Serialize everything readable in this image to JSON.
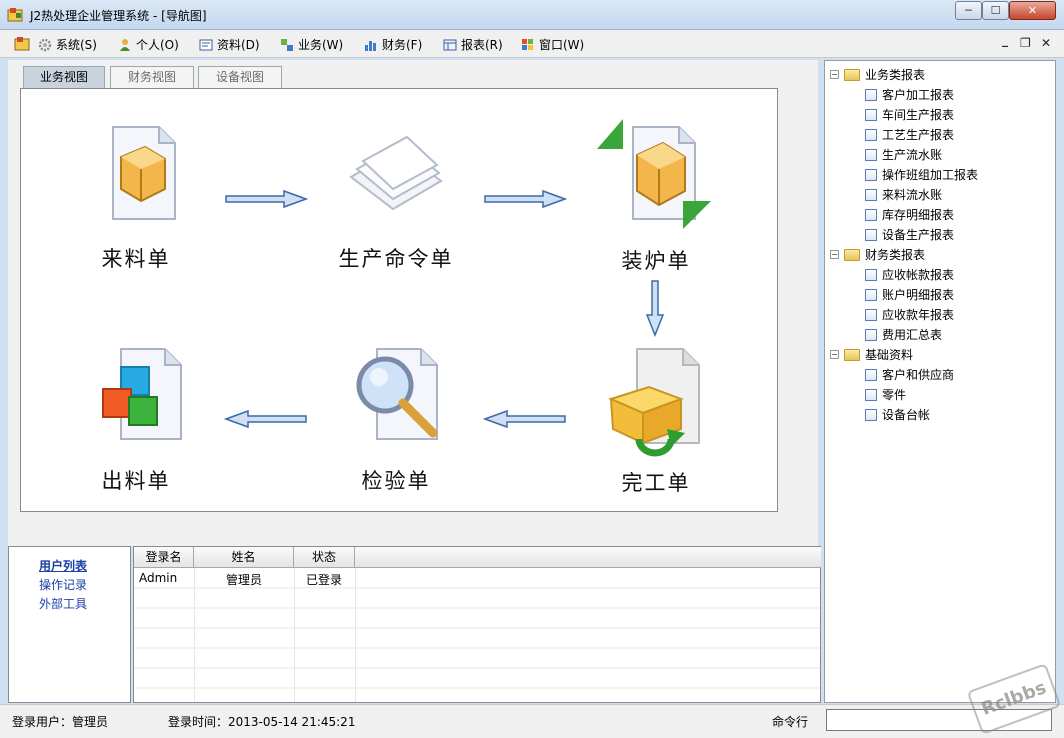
{
  "window": {
    "title": "J2热处理企业管理系统 - [导航图]",
    "controls": {
      "minimize": "─",
      "maximize": "☐",
      "close": "✕"
    }
  },
  "menubar": {
    "items": [
      {
        "label": "系统(S)",
        "icon": "gear-icon"
      },
      {
        "label": "个人(O)",
        "icon": "user-icon"
      },
      {
        "label": "资料(D)",
        "icon": "document-icon"
      },
      {
        "label": "业务(W)",
        "icon": "workflow-icon"
      },
      {
        "label": "财务(F)",
        "icon": "chart-icon"
      },
      {
        "label": "报表(R)",
        "icon": "report-icon"
      },
      {
        "label": "窗口(W)",
        "icon": "window-icon"
      }
    ],
    "mdi": {
      "minimize": "_",
      "restore": "❐",
      "close": "✕"
    }
  },
  "tabs": [
    {
      "label": "业务视图",
      "active": true
    },
    {
      "label": "财务视图",
      "active": false
    },
    {
      "label": "设备视图",
      "active": false
    }
  ],
  "flow": {
    "nodes": [
      {
        "label": "来料单",
        "icon": "incoming-order-icon"
      },
      {
        "label": "生产命令单",
        "icon": "production-order-icon"
      },
      {
        "label": "装炉单",
        "icon": "furnace-loading-icon"
      },
      {
        "label": "完工单",
        "icon": "completion-order-icon"
      },
      {
        "label": "检验单",
        "icon": "inspection-icon"
      },
      {
        "label": "出料单",
        "icon": "outgoing-order-icon"
      }
    ]
  },
  "tree": {
    "groups": [
      {
        "label": "业务类报表",
        "expander": "−",
        "items": [
          "客户加工报表",
          "车间生产报表",
          "工艺生产报表",
          "生产流水账",
          "操作班组加工报表",
          "来料流水账",
          "库存明细报表",
          "设备生产报表"
        ]
      },
      {
        "label": "财务类报表",
        "expander": "−",
        "items": [
          "应收帐款报表",
          "账户明细报表",
          "应收款年报表",
          "费用汇总表"
        ]
      },
      {
        "label": "基础资料",
        "expander": "−",
        "items": [
          "客户和供应商",
          "零件",
          "设备台帐"
        ]
      }
    ]
  },
  "bottom_nav": {
    "items": [
      "用户列表",
      "操作记录",
      "外部工具"
    ]
  },
  "user_table": {
    "columns": [
      "登录名",
      "姓名",
      "状态"
    ],
    "rows": [
      [
        "Admin",
        "管理员",
        "已登录"
      ]
    ]
  },
  "statusbar": {
    "login_user": "登录用户：管理员",
    "login_time": "登录时间：2013-05-14 21:45:21",
    "command_label": "命令行",
    "command_value": ""
  },
  "watermark": "Rclbbs",
  "colors": {
    "accent": "#1c3fa8",
    "titlebar": "#c4d8ef",
    "close": "#c8452b"
  }
}
